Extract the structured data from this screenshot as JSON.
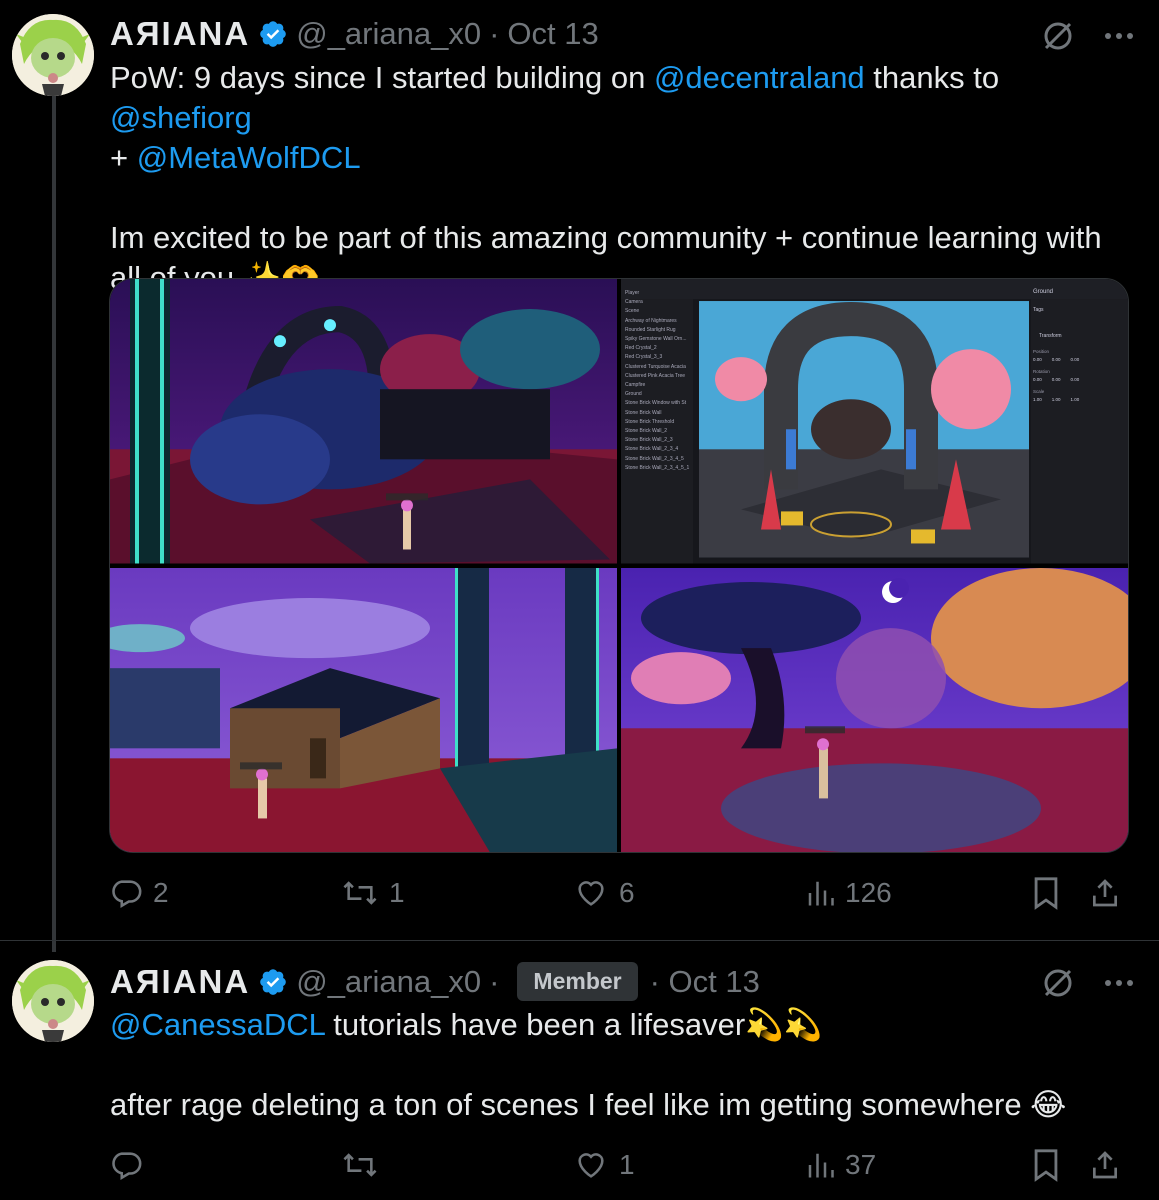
{
  "tweet1": {
    "display_name": "AЯIANA",
    "handle": "@_ariana_x0",
    "separator": "·",
    "date": "Oct 13",
    "text_line1_prefix": "PoW: 9 days since I started building on ",
    "mention1": "@decentraland",
    "text_line1_mid": " thanks to ",
    "mention2": "@shefiorg",
    "text_line2_prefix": "+ ",
    "mention3": "@MetaWolfDCL",
    "text_para2": "Im excited to be part of this amazing community + continue learning with all of you ✨🫶",
    "editor": {
      "top_tab": "Ground",
      "tags_label": "Tags",
      "section": "Transform",
      "position_label": "Position",
      "rotation_label": "Rotation",
      "scale_label": "Scale",
      "pos_values": [
        "0.00",
        "0.00",
        "0.00"
      ],
      "rot_values": [
        "0.00",
        "0.00",
        "0.00"
      ],
      "scale_values": [
        "1.00",
        "1.00",
        "1.00"
      ],
      "tree_items": [
        "Player",
        "Camera",
        "Scene",
        "Archway of Nightmares",
        "Rounded Starlight Rug",
        "Spiky Gemstone Wall Orn...",
        "Red Crystal_2",
        "Red Crystal_3_3",
        "Clustered Turquoise Acacia",
        "Clustered Pink Acacia Tree",
        "Campfire",
        "Ground",
        "Stone Brick Window with St",
        "Stone Brick Wall",
        "Stone Brick Threshold",
        "Stone Brick Wall_2",
        "Stone Brick Wall_2_3",
        "Stone Brick Wall_2_3_4",
        "Stone Brick Wall_2_3_4_5",
        "Stone Brick Wall_2_3_4_5_1"
      ]
    },
    "player_tag": "ariana#2e70",
    "actions": {
      "replies": "2",
      "reposts": "1",
      "likes": "6",
      "views": "126"
    }
  },
  "tweet2": {
    "display_name": "AЯIANA",
    "handle": "@_ariana_x0",
    "separator": "·",
    "badge": "Member",
    "date_prefix": "· Oct 13",
    "mention": "@CanessaDCL",
    "text_line1": " tutorials have been a lifesaver💫💫",
    "text_para2": "after rage deleting a ton of scenes I feel like im getting somewhere 😂",
    "actions": {
      "replies": "",
      "reposts": "",
      "likes": "1",
      "views": "37"
    }
  },
  "colors": {
    "background": "#000000",
    "text": "#e7e9ea",
    "muted": "#71767b",
    "accent": "#1d9bf0",
    "divider": "#2f3336"
  },
  "icons": [
    "verified-badge-icon",
    "grok-icon",
    "more-icon",
    "reply-icon",
    "repost-icon",
    "like-icon",
    "views-icon",
    "bookmark-icon",
    "share-icon"
  ]
}
